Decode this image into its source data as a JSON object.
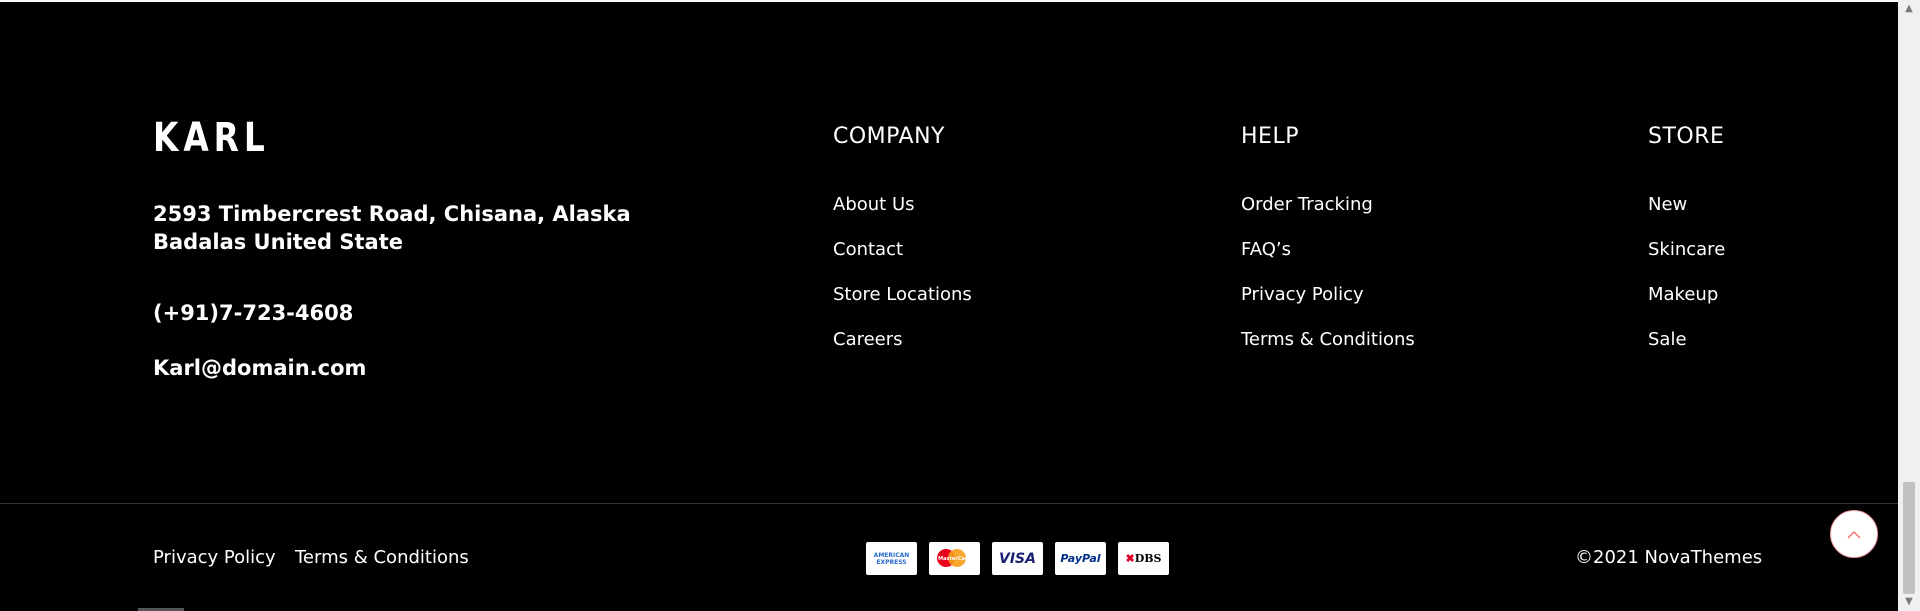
{
  "brand": {
    "logo": "KARL",
    "address": "2593 Timbercrest Road, Chisana, Alaska Badalas United State",
    "phone": "(+91)7-723-4608",
    "email": "Karl@domain.com"
  },
  "columns": {
    "company": {
      "title": "COMPANY",
      "links": [
        "About Us",
        "Contact",
        "Store Locations",
        "Careers"
      ]
    },
    "help": {
      "title": "HELP",
      "links": [
        "Order Tracking",
        "FAQ’s",
        "Privacy Policy",
        "Terms & Conditions"
      ]
    },
    "store": {
      "title": "STORE",
      "links": [
        "New",
        "Skincare",
        "Makeup",
        "Sale"
      ]
    }
  },
  "bottom": {
    "privacy": "Privacy Policy",
    "terms": "Terms & Conditions",
    "copyright": "©2021 NovaThemes",
    "payments": {
      "amex": "AMERICAN EXPRESS",
      "mastercard": "MasterCard",
      "visa": "VISA",
      "paypal": "PayPal",
      "dbs": "DBS"
    }
  },
  "icons": {
    "back_to_top": "chevron-up-icon",
    "scroll_up": "scroll-up-arrow",
    "scroll_down": "scroll-down-arrow"
  }
}
